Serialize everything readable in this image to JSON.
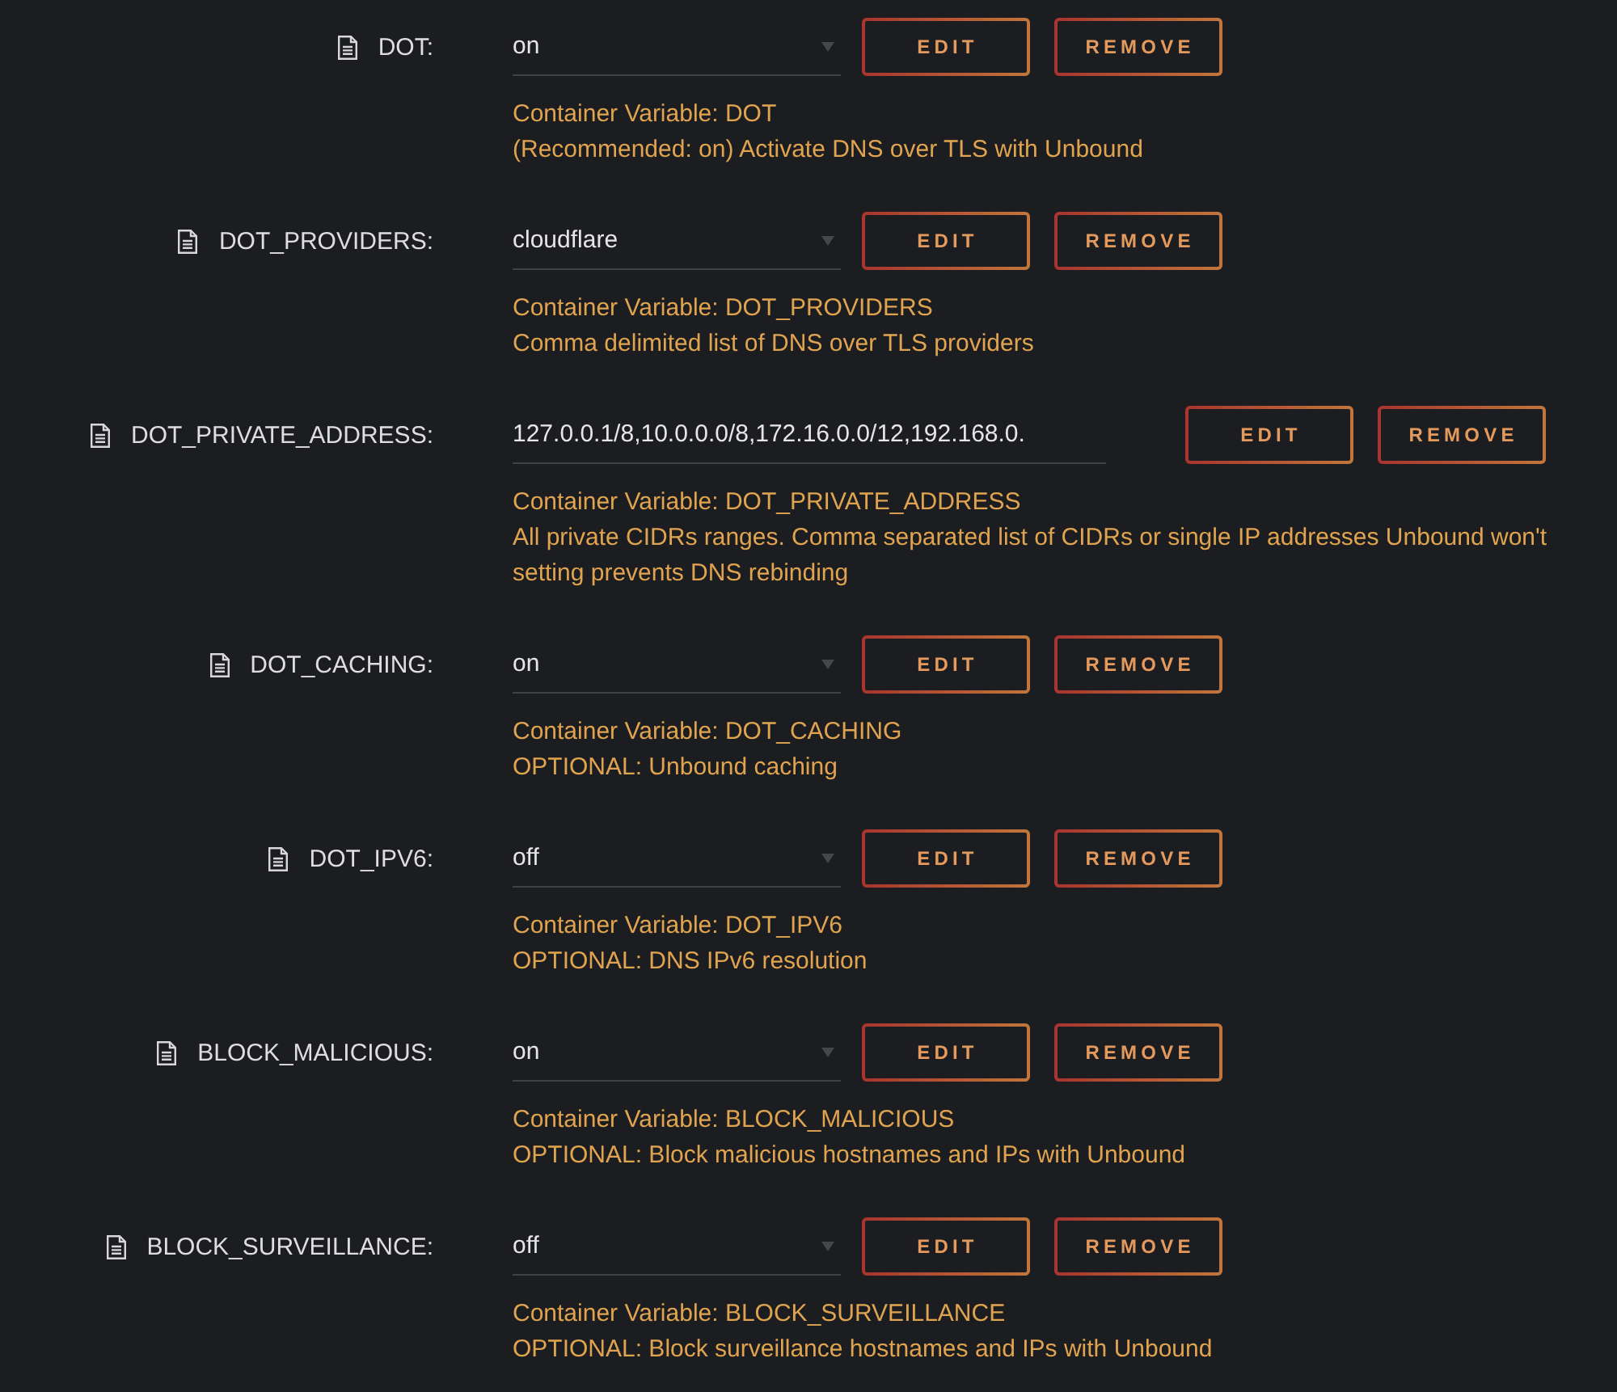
{
  "variables": [
    {
      "name": "DOT:",
      "kind": "select",
      "value": "on",
      "buttons": [
        "EDIT",
        "REMOVE"
      ],
      "description_lines": [
        "Container Variable: DOT",
        "(Recommended: on) Activate DNS over TLS with Unbound"
      ]
    },
    {
      "name": "DOT_PROVIDERS:",
      "kind": "select",
      "value": "cloudflare",
      "buttons": [
        "EDIT",
        "REMOVE"
      ],
      "description_lines": [
        "Container Variable: DOT_PROVIDERS",
        "Comma delimited list of DNS over TLS providers"
      ]
    },
    {
      "name": "DOT_PRIVATE_ADDRESS:",
      "kind": "text",
      "value": "127.0.0.1/8,10.0.0.0/8,172.16.0.0/12,192.168.0.",
      "buttons": [
        "EDIT",
        "REMOVE"
      ],
      "description_lines": [
        "Container Variable: DOT_PRIVATE_ADDRESS",
        "All private CIDRs ranges. Comma separated list of CIDRs or single IP addresses Unbound won't",
        "setting prevents DNS rebinding"
      ]
    },
    {
      "name": "DOT_CACHING:",
      "kind": "select",
      "value": "on",
      "buttons": [
        "EDIT",
        "REMOVE"
      ],
      "description_lines": [
        "Container Variable: DOT_CACHING",
        "OPTIONAL: Unbound caching"
      ]
    },
    {
      "name": "DOT_IPV6:",
      "kind": "select",
      "value": "off",
      "buttons": [
        "EDIT",
        "REMOVE"
      ],
      "description_lines": [
        "Container Variable: DOT_IPV6",
        "OPTIONAL: DNS IPv6 resolution"
      ]
    },
    {
      "name": "BLOCK_MALICIOUS:",
      "kind": "select",
      "value": "on",
      "buttons": [
        "EDIT",
        "REMOVE"
      ],
      "description_lines": [
        "Container Variable: BLOCK_MALICIOUS",
        "OPTIONAL: Block malicious hostnames and IPs with Unbound"
      ]
    },
    {
      "name": "BLOCK_SURVEILLANCE:",
      "kind": "select",
      "value": "off",
      "buttons": [
        "EDIT",
        "REMOVE"
      ],
      "description_lines": [
        "Container Variable: BLOCK_SURVEILLANCE",
        "OPTIONAL: Block surveillance hostnames and IPs with Unbound"
      ]
    }
  ]
}
